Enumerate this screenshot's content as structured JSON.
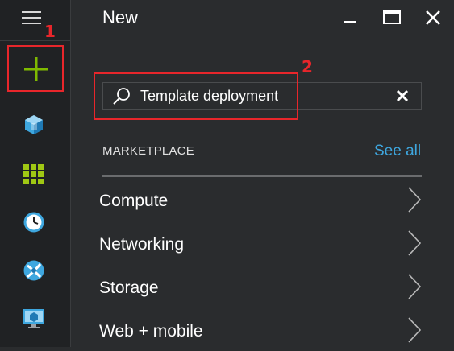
{
  "annotations": {
    "step1": "1",
    "step2": "2"
  },
  "sidebar": {
    "menu_icon": "hamburger-icon",
    "new_icon": "plus-icon",
    "items": [
      {
        "icon": "cube-icon"
      },
      {
        "icon": "grid-icon"
      },
      {
        "icon": "clock-icon"
      },
      {
        "icon": "globe-icon"
      },
      {
        "icon": "monitor-icon"
      }
    ]
  },
  "panel": {
    "title": "New",
    "controls": [
      "minimize-icon",
      "maximize-icon",
      "close-icon"
    ]
  },
  "search": {
    "value": "Template deployment"
  },
  "marketplace": {
    "heading": "MARKETPLACE",
    "see_all": "See all",
    "items": [
      {
        "label": "Compute"
      },
      {
        "label": "Networking"
      },
      {
        "label": "Storage"
      },
      {
        "label": "Web + mobile"
      }
    ]
  },
  "colors": {
    "accent": "#3ea7df",
    "annotation": "#e8262b",
    "plus": "#7fba00",
    "background": "#2a2c2e",
    "sidebar": "#202224"
  }
}
